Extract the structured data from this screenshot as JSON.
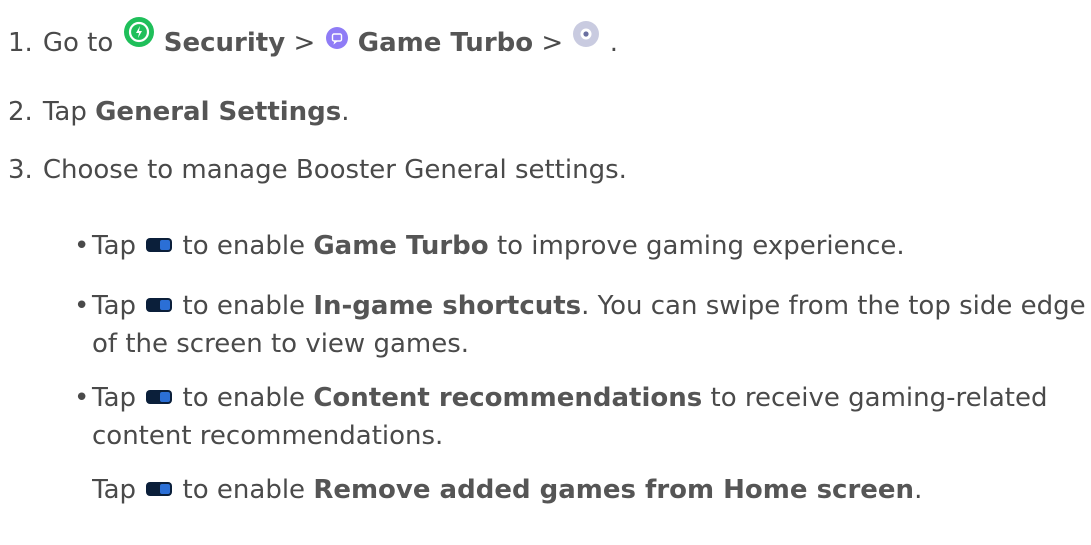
{
  "steps": [
    {
      "number": "1.",
      "parts": {
        "go_to": "Go to",
        "security": "Security",
        "sep1": ">",
        "game_turbo": "Game Turbo",
        "sep2": ">",
        "end": "."
      }
    },
    {
      "number": "2.",
      "parts": {
        "tap": "Tap",
        "general_settings": "General Settings",
        "end": "."
      }
    },
    {
      "number": "3.",
      "text": "Choose to manage Booster General settings."
    }
  ],
  "bullets": [
    {
      "tap": "Tap",
      "to_enable": "to enable",
      "bold": "Game Turbo",
      "rest": "to improve gaming experience."
    },
    {
      "tap": "Tap",
      "to_enable": "to enable",
      "bold": "In-game shortcuts",
      "rest": ". You can swipe from the top side edge of the screen to view games."
    },
    {
      "tap": "Tap",
      "to_enable": "to enable",
      "bold": "Content recommendations",
      "rest": "to receive gaming-related content recommendations."
    },
    {
      "tap": "Tap",
      "to_enable": "to enable",
      "bold": "Remove added games from Home screen",
      "rest": "."
    }
  ],
  "icons": {
    "security": "security-shield-icon",
    "game_turbo": "game-turbo-icon",
    "settings": "settings-gear-icon",
    "toggle": "toggle-switch-icon"
  },
  "colors": {
    "security": "#1fbf5a",
    "game_turbo": "#8f7cf6",
    "settings": "#c9cbe0",
    "toggle": "#0b1f3a",
    "text": "#4a4a4a"
  }
}
